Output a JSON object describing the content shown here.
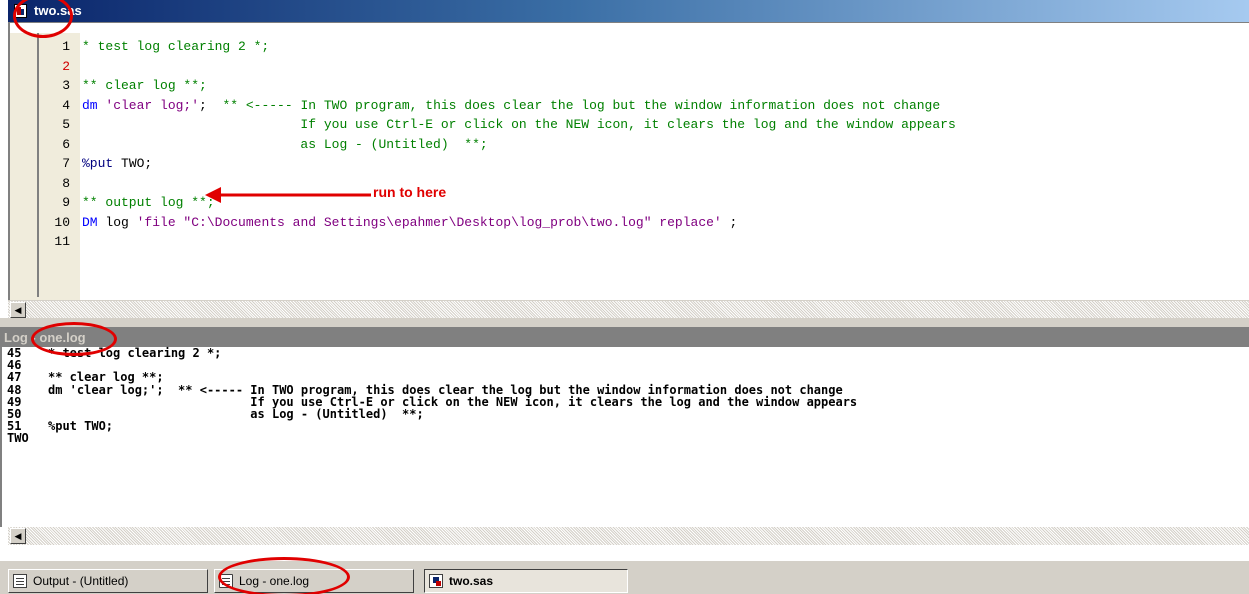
{
  "editor": {
    "title": "two.sas",
    "lines": [
      {
        "num": "1",
        "parts": [
          {
            "text": "* test log clearing 2 *;",
            "cls": "c-green"
          }
        ]
      },
      {
        "num": "2",
        "red": true,
        "parts": []
      },
      {
        "num": "3",
        "parts": [
          {
            "text": "** clear log **;",
            "cls": "c-green"
          }
        ]
      },
      {
        "num": "4",
        "parts": [
          {
            "text": "dm ",
            "cls": "c-blue"
          },
          {
            "text": "'clear log;'",
            "cls": "c-purple"
          },
          {
            "text": ";  ",
            "cls": "c-black"
          },
          {
            "text": "** <----- In TWO program, this does clear the log but the window information does not change",
            "cls": "c-green"
          }
        ]
      },
      {
        "num": "5",
        "parts": [
          {
            "text": "                            If you use Ctrl-E or click on the NEW icon, it clears the log and the window appears",
            "cls": "c-green"
          }
        ]
      },
      {
        "num": "6",
        "parts": [
          {
            "text": "                            as Log - (Untitled)  **;",
            "cls": "c-green"
          }
        ]
      },
      {
        "num": "7",
        "parts": [
          {
            "text": "%put ",
            "cls": "c-navy"
          },
          {
            "text": "TWO;",
            "cls": "c-black"
          }
        ]
      },
      {
        "num": "8",
        "parts": []
      },
      {
        "num": "9",
        "parts": [
          {
            "text": "** output log **;",
            "cls": "c-green"
          }
        ]
      },
      {
        "num": "10",
        "parts": [
          {
            "text": "DM ",
            "cls": "c-blue"
          },
          {
            "text": "log ",
            "cls": "c-black"
          },
          {
            "text": "'file \"C:\\Documents and Settings\\epahmer\\Desktop\\log_prob\\two.log\" replace'",
            "cls": "c-purple"
          },
          {
            "text": " ;",
            "cls": "c-black"
          }
        ]
      },
      {
        "num": "11",
        "parts": []
      }
    ]
  },
  "annotation": {
    "arrow_label": "run to here",
    "color": "#e00000"
  },
  "log": {
    "title": "Log - one.log",
    "lines": [
      {
        "num": "45",
        "text": "* test log clearing 2 *;"
      },
      {
        "num": "46",
        "text": ""
      },
      {
        "num": "47",
        "text": "** clear log **;"
      },
      {
        "num": "48",
        "text": "dm 'clear log;';  ** <----- In TWO program, this does clear the log but the window information does not change"
      },
      {
        "num": "49",
        "text": "                            If you use Ctrl-E or click on the NEW icon, it clears the log and the window appears"
      },
      {
        "num": "50",
        "text": "                            as Log - (Untitled)  **;"
      },
      {
        "num": "51",
        "text": "%put TWO;"
      },
      {
        "num": "TWO",
        "text": ""
      }
    ]
  },
  "taskbar": {
    "buttons": [
      {
        "label": "Output - (Untitled)",
        "icon": "output-icon"
      },
      {
        "label": "Log - one.log",
        "icon": "log-icon"
      },
      {
        "label": "two.sas",
        "icon": "sas-program-icon",
        "active": true
      }
    ]
  },
  "colors": {
    "comment": "#008000",
    "keyword": "#0000ff",
    "string": "#800080",
    "macro": "#000080",
    "title_active": "#0a246a",
    "title_inactive": "#808080"
  }
}
